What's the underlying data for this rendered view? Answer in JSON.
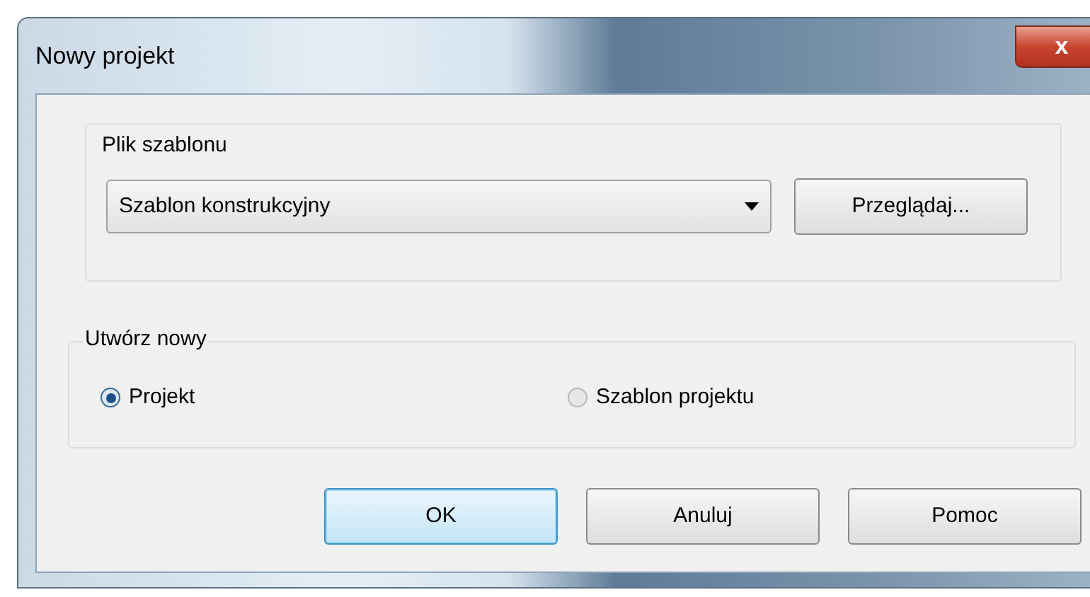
{
  "window": {
    "title": "Nowy projekt",
    "close_label": "x"
  },
  "template_group": {
    "label": "Plik szablonu",
    "dropdown_value": "Szablon konstrukcyjny",
    "browse_button": "Przeglądaj..."
  },
  "create_group": {
    "label": "Utwórz nowy",
    "options": [
      {
        "label": "Projekt",
        "selected": true
      },
      {
        "label": "Szablon projektu",
        "selected": false
      }
    ]
  },
  "buttons": [
    {
      "label": "OK",
      "default": true
    },
    {
      "label": "Anuluj",
      "default": false
    },
    {
      "label": "Pomoc",
      "default": false
    }
  ]
}
